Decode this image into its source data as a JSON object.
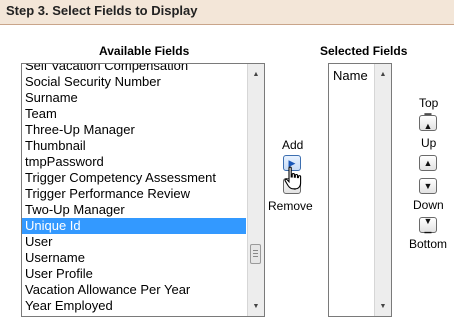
{
  "step_header": {
    "title": "Step 3. Select Fields to Display"
  },
  "available": {
    "label": "Available Fields",
    "options": [
      "Self Vacation Compensation",
      "Social Security Number",
      "Surname",
      "Team",
      "Three-Up Manager",
      "Thumbnail",
      "tmpPassword",
      "Trigger Competency Assessment",
      "Trigger Performance Review",
      "Two-Up Manager",
      "Unique Id",
      "User",
      "Username",
      "User Profile",
      "Vacation Allowance Per Year",
      "Year Employed"
    ],
    "selected": "Unique Id"
  },
  "selected_fields": {
    "label": "Selected Fields",
    "options": [
      "Name"
    ]
  },
  "transfer": {
    "add_label": "Add",
    "remove_label": "Remove"
  },
  "order": {
    "top_label": "Top",
    "up_label": "Up",
    "down_label": "Down",
    "bottom_label": "Bottom"
  },
  "icons": {
    "add": "arrow-right-icon",
    "remove": "arrow-left-icon",
    "top": "arrow-top-icon",
    "up": "arrow-up-icon",
    "down": "arrow-down-icon",
    "bottom": "arrow-bottom-icon",
    "cursor": "hand-pointer-icon"
  },
  "colors": {
    "header_bg": "#f3e6d8",
    "selection": "#3399ff",
    "add_button": "#1a57b8"
  }
}
